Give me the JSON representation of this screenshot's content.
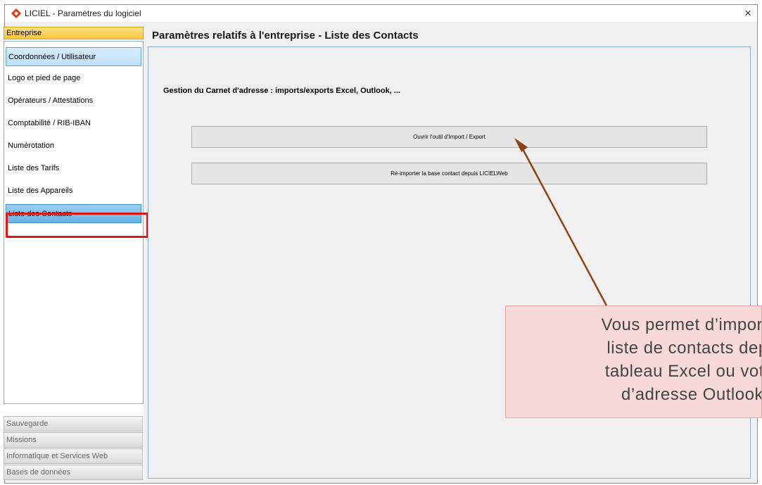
{
  "window": {
    "title": "LICIEL - Paramètres du logiciel",
    "close_label": "×"
  },
  "sidebar": {
    "section_header": "Entreprise",
    "items": [
      {
        "label": "Coordonnées / Utilisateur"
      },
      {
        "label": "Logo et pied de page"
      },
      {
        "label": "Opérateurs / Attestations"
      },
      {
        "label": "Comptabilité / RIB-IBAN"
      },
      {
        "label": "Numérotation"
      },
      {
        "label": "Liste des Tarifs"
      },
      {
        "label": "Liste des Appareils"
      },
      {
        "label": "Liste des Contacts"
      }
    ],
    "bottom_sections": [
      {
        "label": "Sauvegarde"
      },
      {
        "label": "Missions"
      },
      {
        "label": "Informatique et Services Web"
      },
      {
        "label": "Bases de données"
      }
    ]
  },
  "main": {
    "title": "Paramètres relatifs à l'entreprise - Liste des Contacts",
    "section_label": "Gestion du Carnet d'adresse : imports/exports Excel, Outlook, ...",
    "buttons": [
      {
        "label": "Ouvrir l'outil d'Import / Export"
      },
      {
        "label": "Ré-importer la base contact depuis LICIELWeb"
      }
    ]
  },
  "callout": {
    "text": "Vous permet d’importer\nliste de contacts depu\ntableau Excel ou votre\nd’adresse Outlook"
  },
  "colors": {
    "highlight": "#e01515",
    "arrow": "#8b4513",
    "callout_bg": "#f8d9d9",
    "section_header": "#ffc83d"
  }
}
